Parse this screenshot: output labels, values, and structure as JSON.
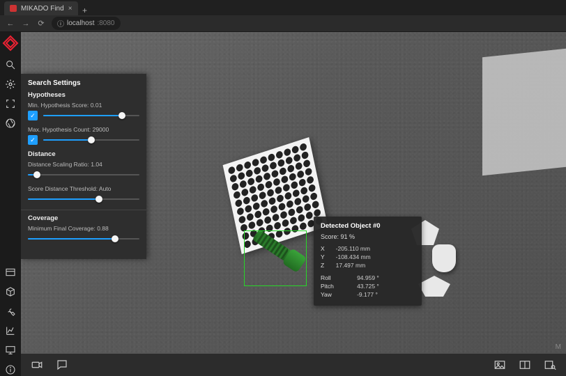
{
  "browser": {
    "tab_title": "MIKADO Find",
    "url_prefix": "localhost",
    "url_port": ":8080"
  },
  "panel": {
    "title": "Search Settings",
    "sections": {
      "hypotheses": {
        "title": "Hypotheses",
        "min_score": {
          "label": "Min. Hypothesis Score: 0.01",
          "enabled": true,
          "pct": 82
        },
        "max_count": {
          "label": "Max. Hypothesis Count: 29000",
          "enabled": true,
          "pct": 50
        }
      },
      "distance": {
        "title": "Distance",
        "scaling": {
          "label": "Distance Scaling Ratio: 1.04",
          "pct": 8
        },
        "threshold": {
          "label": "Score Distance Threshold: Auto",
          "pct": 64
        }
      },
      "coverage": {
        "title": "Coverage",
        "min_final": {
          "label": "Minimum Final Coverage: 0.88",
          "pct": 78
        }
      }
    }
  },
  "detection": {
    "title": "Detected Object #0",
    "score_label": "Score: 91 %",
    "pos": {
      "x": {
        "k": "X",
        "v": "-205.110 mm"
      },
      "y": {
        "k": "Y",
        "v": "-108.434 mm"
      },
      "z": {
        "k": "Z",
        "v": "17.497 mm"
      }
    },
    "rot": {
      "roll": {
        "k": "Roll",
        "v": "94.959 °"
      },
      "pitch": {
        "k": "Pitch",
        "v": "43.725 °"
      },
      "yaw": {
        "k": "Yaw",
        "v": "-9.177 °"
      }
    }
  },
  "brand_hint": "M"
}
